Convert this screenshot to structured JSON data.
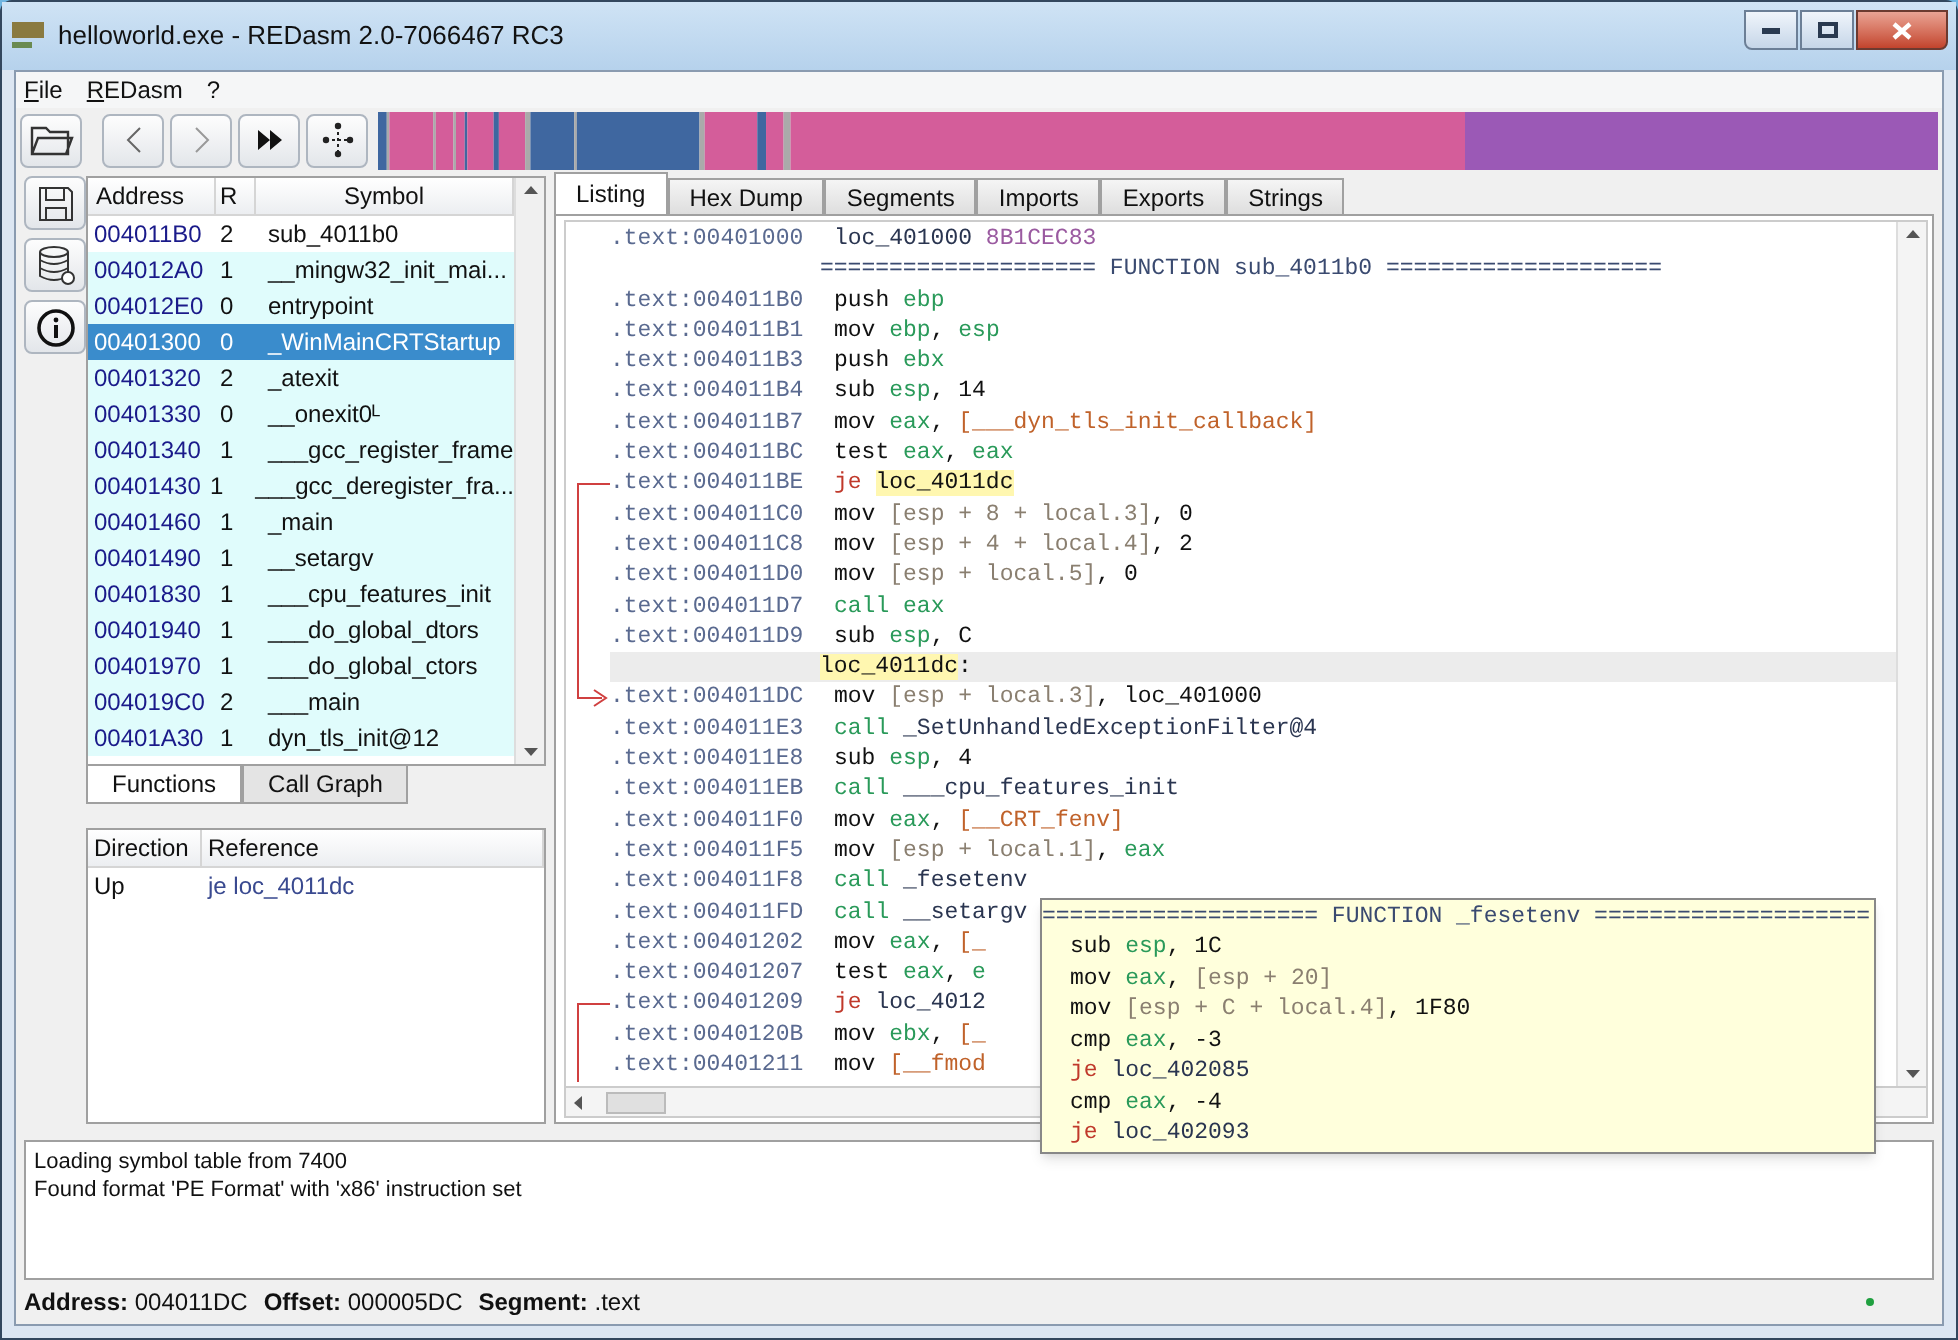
{
  "window": {
    "title": "helloworld.exe - REDasm 2.0-7066467 RC3"
  },
  "menu": [
    {
      "label": "File"
    },
    {
      "label": "REDasm"
    },
    {
      "label": "?"
    }
  ],
  "functions": {
    "columns": [
      "Address",
      "R",
      "Symbol"
    ],
    "rows": [
      {
        "address": "004011B0",
        "r": "2",
        "symbol": "sub_4011b0",
        "selected": false,
        "highlighted": false
      },
      {
        "address": "004012A0",
        "r": "1",
        "symbol": "__mingw32_init_mai...",
        "selected": false,
        "highlighted": true
      },
      {
        "address": "004012E0",
        "r": "0",
        "symbol": "entrypoint",
        "selected": false,
        "highlighted": true
      },
      {
        "address": "00401300",
        "r": "0",
        "symbol": "_WinMainCRTStartup",
        "selected": true,
        "highlighted": true
      },
      {
        "address": "00401320",
        "r": "2",
        "symbol": "_atexit",
        "selected": false,
        "highlighted": true
      },
      {
        "address": "00401330",
        "r": "0",
        "symbol": "__onexit0ᴸ",
        "selected": false,
        "highlighted": true
      },
      {
        "address": "00401340",
        "r": "1",
        "symbol": "___gcc_register_frame",
        "selected": false,
        "highlighted": true
      },
      {
        "address": "00401430",
        "r": "1",
        "symbol": "___gcc_deregister_fra...",
        "selected": false,
        "highlighted": true
      },
      {
        "address": "00401460",
        "r": "1",
        "symbol": "_main",
        "selected": false,
        "highlighted": true
      },
      {
        "address": "00401490",
        "r": "1",
        "symbol": "__setargv",
        "selected": false,
        "highlighted": true
      },
      {
        "address": "00401830",
        "r": "1",
        "symbol": "___cpu_features_init",
        "selected": false,
        "highlighted": true
      },
      {
        "address": "00401940",
        "r": "1",
        "symbol": "___do_global_dtors",
        "selected": false,
        "highlighted": true
      },
      {
        "address": "00401970",
        "r": "1",
        "symbol": "___do_global_ctors",
        "selected": false,
        "highlighted": true
      },
      {
        "address": "004019C0",
        "r": "2",
        "symbol": "___main",
        "selected": false,
        "highlighted": true
      },
      {
        "address": "00401A30",
        "r": "1",
        "symbol": "dyn_tls_init@12",
        "selected": false,
        "highlighted": true
      }
    ]
  },
  "left_tabs": [
    {
      "label": "Functions",
      "selected": true
    },
    {
      "label": "Call Graph",
      "selected": false
    }
  ],
  "references": {
    "columns": [
      "Direction",
      "Reference"
    ],
    "rows": [
      {
        "direction": "Up",
        "reference": "je loc_4011dc"
      }
    ]
  },
  "tabs": [
    {
      "label": "Listing",
      "selected": true
    },
    {
      "label": "Hex Dump",
      "selected": false
    },
    {
      "label": "Segments",
      "selected": false
    },
    {
      "label": "Imports",
      "selected": false
    },
    {
      "label": "Exports",
      "selected": false
    },
    {
      "label": "Strings",
      "selected": false
    }
  ],
  "listing": [
    {
      "address": ".text:00401000",
      "current": false,
      "parts": [
        {
          "text": "loc_401000 ",
          "kind": "name"
        },
        {
          "text": "8B1CEC83",
          "kind": "hex"
        }
      ]
    },
    {
      "current": false,
      "parts": [
        {
          "text": "==================== FUNCTION sub_4011b0 ====================",
          "kind": "func"
        }
      ]
    },
    {
      "address": ".text:004011B0",
      "current": false,
      "parts": [
        {
          "text": "push ",
          "kind": "plain"
        },
        {
          "text": "ebp",
          "kind": "reg"
        }
      ]
    },
    {
      "address": ".text:004011B1",
      "current": false,
      "parts": [
        {
          "text": "mov ",
          "kind": "plain"
        },
        {
          "text": "ebp",
          "kind": "reg"
        },
        {
          "text": ", ",
          "kind": "plain"
        },
        {
          "text": "esp",
          "kind": "reg"
        }
      ]
    },
    {
      "address": ".text:004011B3",
      "current": false,
      "parts": [
        {
          "text": "push ",
          "kind": "plain"
        },
        {
          "text": "ebx",
          "kind": "reg"
        }
      ]
    },
    {
      "address": ".text:004011B4",
      "current": false,
      "parts": [
        {
          "text": "sub ",
          "kind": "plain"
        },
        {
          "text": "esp",
          "kind": "reg"
        },
        {
          "text": ", 14",
          "kind": "plain"
        }
      ]
    },
    {
      "address": ".text:004011B7",
      "current": false,
      "parts": [
        {
          "text": "mov ",
          "kind": "plain"
        },
        {
          "text": "eax",
          "kind": "reg"
        },
        {
          "text": ", ",
          "kind": "plain"
        },
        {
          "text": "[___dyn_tls_init_callback]",
          "kind": "sym"
        }
      ]
    },
    {
      "address": ".text:004011BC",
      "current": false,
      "parts": [
        {
          "text": "test ",
          "kind": "plain"
        },
        {
          "text": "eax",
          "kind": "reg"
        },
        {
          "text": ", ",
          "kind": "plain"
        },
        {
          "text": "eax",
          "kind": "reg"
        }
      ]
    },
    {
      "address": ".text:004011BE",
      "current": false,
      "parts": [
        {
          "text": "je ",
          "kind": "jump"
        },
        {
          "text": "loc_4011dc",
          "kind": "label"
        }
      ]
    },
    {
      "address": ".text:004011C0",
      "current": false,
      "parts": [
        {
          "text": "mov ",
          "kind": "plain"
        },
        {
          "text": "[esp + 8 + local.3]",
          "kind": "mem"
        },
        {
          "text": ", 0",
          "kind": "plain"
        }
      ]
    },
    {
      "address": ".text:004011C8",
      "current": false,
      "parts": [
        {
          "text": "mov ",
          "kind": "plain"
        },
        {
          "text": "[esp + 4 + local.4]",
          "kind": "mem"
        },
        {
          "text": ", 2",
          "kind": "plain"
        }
      ]
    },
    {
      "address": ".text:004011D0",
      "current": false,
      "parts": [
        {
          "text": "mov ",
          "kind": "plain"
        },
        {
          "text": "[esp + local.5]",
          "kind": "mem"
        },
        {
          "text": ", 0",
          "kind": "plain"
        }
      ]
    },
    {
      "address": ".text:004011D7",
      "current": false,
      "parts": [
        {
          "text": "call ",
          "kind": "call"
        },
        {
          "text": "eax",
          "kind": "reg"
        }
      ]
    },
    {
      "address": ".text:004011D9",
      "current": false,
      "parts": [
        {
          "text": "sub ",
          "kind": "plain"
        },
        {
          "text": "esp",
          "kind": "reg"
        },
        {
          "text": ", C",
          "kind": "plain"
        }
      ]
    },
    {
      "current": true,
      "parts": [
        {
          "text": "loc_4011dc",
          "kind": "label"
        },
        {
          "text": ":",
          "kind": "plain"
        }
      ]
    },
    {
      "address": ".text:004011DC",
      "current": false,
      "parts": [
        {
          "text": "mov ",
          "kind": "plain"
        },
        {
          "text": "[esp + local.3]",
          "kind": "mem"
        },
        {
          "text": ", loc_401000",
          "kind": "plain"
        }
      ]
    },
    {
      "address": ".text:004011E3",
      "current": false,
      "parts": [
        {
          "text": "call ",
          "kind": "call"
        },
        {
          "text": "_SetUnhandledExceptionFilter@4",
          "kind": "name"
        }
      ]
    },
    {
      "address": ".text:004011E8",
      "current": false,
      "parts": [
        {
          "text": "sub ",
          "kind": "plain"
        },
        {
          "text": "esp",
          "kind": "reg"
        },
        {
          "text": ", 4",
          "kind": "plain"
        }
      ]
    },
    {
      "address": ".text:004011EB",
      "current": false,
      "parts": [
        {
          "text": "call ",
          "kind": "call"
        },
        {
          "text": "___cpu_features_init",
          "kind": "name"
        }
      ]
    },
    {
      "address": ".text:004011F0",
      "current": false,
      "parts": [
        {
          "text": "mov ",
          "kind": "plain"
        },
        {
          "text": "eax",
          "kind": "reg"
        },
        {
          "text": ", ",
          "kind": "plain"
        },
        {
          "text": "[__CRT_fenv]",
          "kind": "sym"
        }
      ]
    },
    {
      "address": ".text:004011F5",
      "current": false,
      "parts": [
        {
          "text": "mov ",
          "kind": "plain"
        },
        {
          "text": "[esp + local.1]",
          "kind": "mem"
        },
        {
          "text": ", ",
          "kind": "plain"
        },
        {
          "text": "eax",
          "kind": "reg"
        }
      ]
    },
    {
      "address": ".text:004011F8",
      "current": false,
      "parts": [
        {
          "text": "call ",
          "kind": "call"
        },
        {
          "text": "_fesetenv",
          "kind": "name"
        }
      ]
    },
    {
      "address": ".text:004011FD",
      "current": false,
      "parts": [
        {
          "text": "call ",
          "kind": "call"
        },
        {
          "text": "__setargv",
          "kind": "name"
        }
      ]
    },
    {
      "address": ".text:00401202",
      "current": false,
      "parts": [
        {
          "text": "mov ",
          "kind": "plain"
        },
        {
          "text": "eax",
          "kind": "reg"
        },
        {
          "text": ", ",
          "kind": "plain"
        },
        {
          "text": "[_",
          "kind": "sym"
        }
      ]
    },
    {
      "address": ".text:00401207",
      "current": false,
      "parts": [
        {
          "text": "test ",
          "kind": "plain"
        },
        {
          "text": "eax",
          "kind": "reg"
        },
        {
          "text": ", ",
          "kind": "plain"
        },
        {
          "text": "e",
          "kind": "reg"
        }
      ]
    },
    {
      "address": ".text:00401209",
      "current": false,
      "parts": [
        {
          "text": "je ",
          "kind": "jump"
        },
        {
          "text": "loc_4012",
          "kind": "name"
        }
      ]
    },
    {
      "address": ".text:0040120B",
      "current": false,
      "parts": [
        {
          "text": "mov ",
          "kind": "plain"
        },
        {
          "text": "ebx",
          "kind": "reg"
        },
        {
          "text": ", ",
          "kind": "plain"
        },
        {
          "text": "[_",
          "kind": "sym"
        }
      ]
    },
    {
      "address": ".text:00401211",
      "current": false,
      "parts": [
        {
          "text": "mov ",
          "kind": "plain"
        },
        {
          "text": "[__fmod",
          "kind": "sym"
        }
      ]
    }
  ],
  "tooltip": {
    "title": "==================== FUNCTION _fesetenv ====================",
    "lines": [
      {
        "parts": [
          {
            "text": "sub ",
            "kind": "plain"
          },
          {
            "text": "esp",
            "kind": "reg"
          },
          {
            "text": ", 1C",
            "kind": "plain"
          }
        ]
      },
      {
        "parts": [
          {
            "text": "mov ",
            "kind": "plain"
          },
          {
            "text": "eax",
            "kind": "reg"
          },
          {
            "text": ", ",
            "kind": "plain"
          },
          {
            "text": "[esp + 20]",
            "kind": "mem"
          }
        ]
      },
      {
        "parts": [
          {
            "text": "mov ",
            "kind": "plain"
          },
          {
            "text": "[esp + C + local.4]",
            "kind": "mem"
          },
          {
            "text": ", 1F80",
            "kind": "plain"
          }
        ]
      },
      {
        "parts": [
          {
            "text": "cmp ",
            "kind": "plain"
          },
          {
            "text": "eax",
            "kind": "reg"
          },
          {
            "text": ", -3",
            "kind": "plain"
          }
        ]
      },
      {
        "parts": [
          {
            "text": "je ",
            "kind": "jump"
          },
          {
            "text": "loc_402085",
            "kind": "name"
          }
        ]
      },
      {
        "parts": [
          {
            "text": "cmp ",
            "kind": "plain"
          },
          {
            "text": "eax",
            "kind": "reg"
          },
          {
            "text": ", -4",
            "kind": "plain"
          }
        ]
      },
      {
        "parts": [
          {
            "text": "je ",
            "kind": "jump"
          },
          {
            "text": "loc_402093",
            "kind": "name"
          }
        ]
      }
    ]
  },
  "log": [
    "Loading symbol table from 7400",
    "Found format 'PE Format' with 'x86' instruction set"
  ],
  "status_bar": [
    {
      "label": "Address:",
      "value": "004011DC"
    },
    {
      "label": "Offset:",
      "value": "000005DC"
    },
    {
      "label": "Segment:",
      "value": ".text"
    }
  ]
}
